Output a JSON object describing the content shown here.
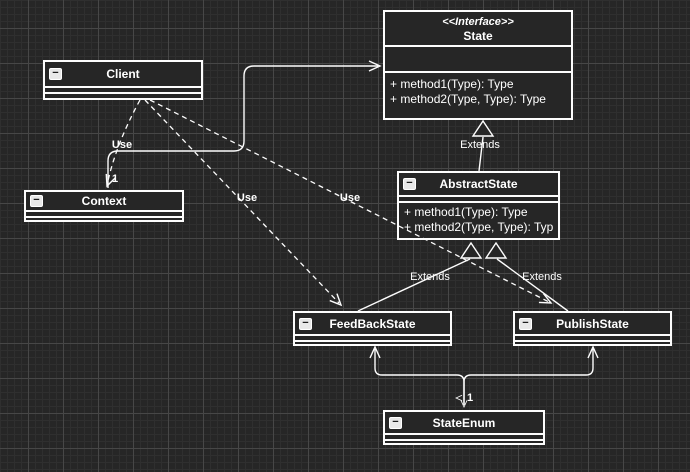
{
  "icons": {
    "collapse_glyph": "−"
  },
  "labels": {
    "use": "Use",
    "extends": "Extends",
    "multiplicity_context": "1",
    "multiplicity_stateenum": "1"
  },
  "classes": [
    {
      "id": "state",
      "stereotype": "<<Interface>>",
      "name": "State",
      "methods": [
        "+ method1(Type): Type",
        "+ method2(Type, Type): Type"
      ]
    },
    {
      "id": "client",
      "name": "Client"
    },
    {
      "id": "context",
      "name": "Context"
    },
    {
      "id": "abstractstate",
      "name": "AbstractState",
      "methods": [
        "+ method1(Type): Type",
        "+ method2(Type, Type): Typ"
      ]
    },
    {
      "id": "feedbackstate",
      "name": "FeedBackState"
    },
    {
      "id": "publishstate",
      "name": "PublishState"
    },
    {
      "id": "stateenum",
      "name": "StateEnum"
    }
  ],
  "edges": [
    {
      "from": "Context",
      "to": "State",
      "type": "association"
    },
    {
      "from": "Client",
      "to": "Context",
      "type": "use-dependency"
    },
    {
      "from": "Client",
      "to": "FeedBackState",
      "type": "use-dependency"
    },
    {
      "from": "Client",
      "to": "PublishState",
      "type": "use-dependency"
    },
    {
      "from": "AbstractState",
      "to": "State",
      "type": "extends"
    },
    {
      "from": "FeedBackState",
      "to": "AbstractState",
      "type": "extends"
    },
    {
      "from": "PublishState",
      "to": "AbstractState",
      "type": "extends"
    },
    {
      "from": "StateEnum",
      "to": "FeedBackState/PublishState",
      "type": "association"
    }
  ]
}
